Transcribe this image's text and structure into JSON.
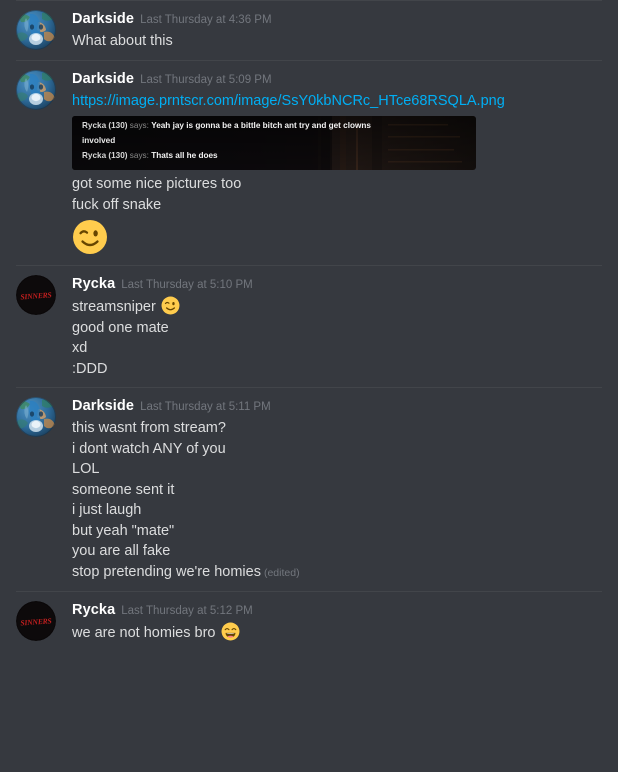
{
  "app": {
    "name": "discord-chat",
    "theme": "dark",
    "background": "#36393f"
  },
  "colors": {
    "background": "#36393f",
    "divider": "#42454a",
    "username": "#ffffff",
    "timestamp": "#72767d",
    "text": "#dcddde",
    "link": "#00aff4",
    "edited": "#72767d",
    "avatar_sinners_text": "#c41f1f"
  },
  "groups": [
    {
      "author": "Darkside",
      "timestamp": "Last Thursday at 4:36 PM",
      "avatar": "darkside-avatar",
      "lines": [
        {
          "type": "text",
          "text": "What about this"
        }
      ]
    },
    {
      "author": "Darkside",
      "timestamp": "Last Thursday at 5:09 PM",
      "avatar": "darkside-avatar",
      "lines": [
        {
          "type": "link",
          "text": "https://image.prntscr.com/image/SsY0kbNCRc_HTce68RSQLA.png"
        },
        {
          "type": "image-embed",
          "alt": "screenshot-embed"
        },
        {
          "type": "text",
          "text": "got some nice pictures too"
        },
        {
          "type": "text",
          "text": "fuck off snake"
        },
        {
          "type": "emoji-jumbo",
          "emoji": "winking-face"
        }
      ]
    },
    {
      "author": "Rycka",
      "timestamp": "Last Thursday at 5:10 PM",
      "avatar": "sinners-avatar",
      "lines": [
        {
          "type": "text-emoji",
          "text": "streamsniper ",
          "emoji": "winking-face"
        },
        {
          "type": "text",
          "text": "good one mate"
        },
        {
          "type": "text",
          "text": "xd"
        },
        {
          "type": "text",
          "text": ":DDD"
        }
      ]
    },
    {
      "author": "Darkside",
      "timestamp": "Last Thursday at 5:11 PM",
      "avatar": "darkside-avatar",
      "lines": [
        {
          "type": "text",
          "text": "this wasnt from stream?"
        },
        {
          "type": "text",
          "text": "i dont watch ANY of you"
        },
        {
          "type": "text",
          "text": "LOL"
        },
        {
          "type": "text",
          "text": "someone sent it"
        },
        {
          "type": "text",
          "text": "i just laugh"
        },
        {
          "type": "text",
          "text": "but yeah \"mate\""
        },
        {
          "type": "text",
          "text": "you are all fake"
        },
        {
          "type": "text-edited",
          "text": "stop pretending we're homies",
          "edited": "(edited)"
        }
      ]
    },
    {
      "author": "Rycka",
      "timestamp": "Last Thursday at 5:12 PM",
      "avatar": "sinners-avatar",
      "lines": [
        {
          "type": "text-emoji",
          "text": "we are not homies bro ",
          "emoji": "grinning-face"
        }
      ]
    }
  ],
  "embed_image": {
    "name": "game-chat-screenshot",
    "lines": [
      {
        "speaker": "Rycka (130)",
        "says": "says:",
        "message": "Yeah jay is gonna be a bittle bitch ant try and get clowns"
      },
      {
        "speaker": "",
        "says": "",
        "message": "involved"
      },
      {
        "speaker": "Rycka (130)",
        "says": "says:",
        "message": "Thats all he does"
      }
    ]
  },
  "avatar_labels": {
    "sinners": "SINNERS"
  }
}
